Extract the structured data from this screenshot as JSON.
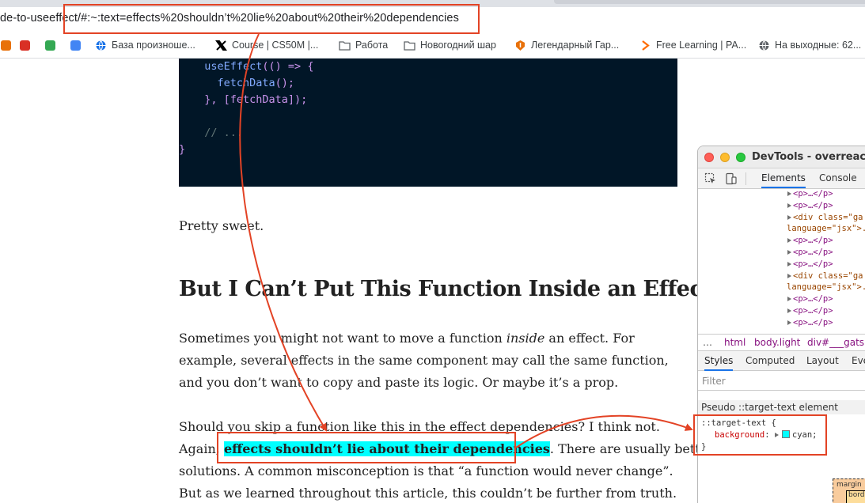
{
  "browser": {
    "url": "de-to-useeffect/#:~:text=effects%20shouldn’t%20lie%20about%20their%20dependencies",
    "bookmarks": [
      {
        "label": "",
        "icon": "bookmark-app-icon-1",
        "color": "#e8710a"
      },
      {
        "label": "",
        "icon": "bookmark-app-icon-2",
        "color": "#d93025"
      },
      {
        "label": "",
        "icon": "bookmark-app-icon-3",
        "color": "#34a853"
      },
      {
        "label": "",
        "icon": "bookmark-app-icon-4",
        "color": "#4285f4"
      },
      {
        "label": "База произноше...",
        "icon": "globe-icon",
        "color": "#1a73e8"
      },
      {
        "label": "Course | CS50M |...",
        "icon": "x-logo-icon",
        "color": "#000000"
      },
      {
        "label": "Работа",
        "icon": "folder-icon",
        "color": "#5f6368"
      },
      {
        "label": "Новогодний шар",
        "icon": "folder-icon",
        "color": "#5f6368"
      },
      {
        "label": "Легендарный Гар...",
        "icon": "shield-icon",
        "color": "#e8710a"
      },
      {
        "label": "Free Learning | PA...",
        "icon": "chevron-right-icon",
        "color": "#ff6b00"
      },
      {
        "label": "На выходные: 62...",
        "icon": "globe-icon",
        "color": "#5f6368"
      }
    ]
  },
  "code": {
    "lines": [
      {
        "indent": "  ",
        "parts": [
          {
            "t": "useEffect",
            "c": "fn"
          },
          {
            "t": "(() => {",
            "c": "p"
          }
        ]
      },
      {
        "indent": "    ",
        "parts": [
          {
            "t": "fetchData",
            "c": "fn"
          },
          {
            "t": "();",
            "c": "p"
          }
        ]
      },
      {
        "indent": "  ",
        "parts": [
          {
            "t": "}, [fetchData]);",
            "c": "p"
          }
        ]
      },
      {
        "indent": "",
        "parts": [
          {
            "t": "",
            "c": "p"
          }
        ]
      },
      {
        "indent": "  ",
        "parts": [
          {
            "t": "// ...",
            "c": "cm"
          }
        ]
      },
      {
        "indent": "",
        "parts": [
          {
            "t": "}",
            "c": "p"
          }
        ]
      }
    ]
  },
  "article": {
    "pretty_sweet": "Pretty sweet.",
    "heading": "But I Can’t Put This Function Inside an Effect",
    "p1": {
      "line1_a": "Sometimes you might not want to move a function ",
      "line1_em": "inside",
      "line1_b": " an effect. For",
      "line2": "example, several effects in the same component may call the same function,",
      "line3": "and you don’t want to copy and paste its logic. Or maybe it’s a prop."
    },
    "p2": {
      "line1": "Should you skip a function like this in the effect dependencies? I think not.",
      "line2_a": "Again, ",
      "line2_hl": "effects shouldn’t lie about their dependencies",
      "line2_b": ". There are usually better",
      "line3": "solutions. A common misconception is that “a function would never change”.",
      "line4": "But as we learned throughout this article, this couldn’t be further from truth."
    }
  },
  "devtools": {
    "title": "DevTools - overreacted",
    "tabs": {
      "elements": "Elements",
      "console": "Console"
    },
    "dom": [
      {
        "text": "<p>…</p>"
      },
      {
        "text": "<p>…</p>"
      },
      {
        "text": "<div class=\"ga"
      },
      {
        "text": "language=\"jsx\">."
      },
      {
        "text": "<p>…</p>"
      },
      {
        "text": "<p>…</p>"
      },
      {
        "text": "<p>…</p>"
      },
      {
        "text": "<div class=\"ga"
      },
      {
        "text": "language=\"jsx\">."
      },
      {
        "text": "<p>…</p>"
      },
      {
        "text": "<p>…</p>"
      },
      {
        "text": "<p>…</p>"
      }
    ],
    "breadcrumbs": [
      "…",
      "html",
      "body.light",
      "div#___gatsby"
    ],
    "style_tabs": {
      "styles": "Styles",
      "computed": "Computed",
      "layout": "Layout",
      "event": "Eve"
    },
    "filter_placeholder": "Filter",
    "pseudo_header": "Pseudo ::target-text element",
    "rule": {
      "selector": "::target-text {",
      "property": "background",
      "value": "cyan;",
      "close": "}"
    },
    "boxmodel_label": "margin",
    "boxmodel_inner": "bord"
  },
  "colors": {
    "annotation": "#e34325",
    "highlight": "#00ffff",
    "code_bg": "#011627"
  }
}
